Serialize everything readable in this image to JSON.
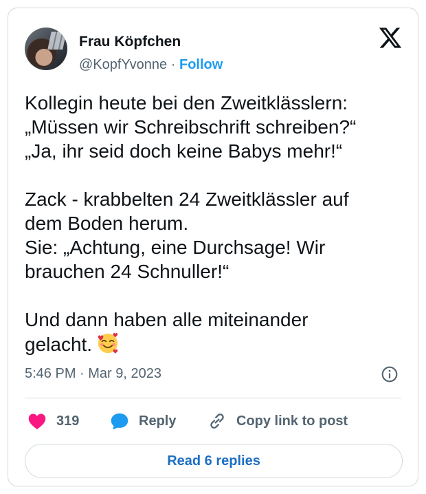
{
  "author": {
    "display_name": "Frau Köpfchen",
    "handle": "@KopfYvonne",
    "separator": "·",
    "follow_label": "Follow"
  },
  "tweet": {
    "paragraphs": [
      "Kollegin heute bei den Zweitklässlern:\n„Müssen wir Schreibschrift schreiben?“\n„Ja, ihr seid doch keine Babys mehr!“",
      "Zack - krabbelten 24 Zweitklässler auf\ndem Boden herum.\nSie: „Achtung, eine Durchsage! Wir\nbrauchen 24 Schnuller!“"
    ],
    "last_line": "Und dann haben alle miteinander\ngelacht.",
    "emoji": "smiling-face-with-hearts-icon",
    "timestamp": "5:46 PM · Mar 9, 2023"
  },
  "actions": {
    "like_count": "319",
    "reply_label": "Reply",
    "copy_link_label": "Copy link to post"
  },
  "read_replies_label": "Read 6 replies",
  "colors": {
    "accent_blue": "#1d9bf0",
    "like_pink": "#f91880",
    "text": "#0f1419",
    "secondary_text": "#536471",
    "border": "#cfd9de"
  }
}
